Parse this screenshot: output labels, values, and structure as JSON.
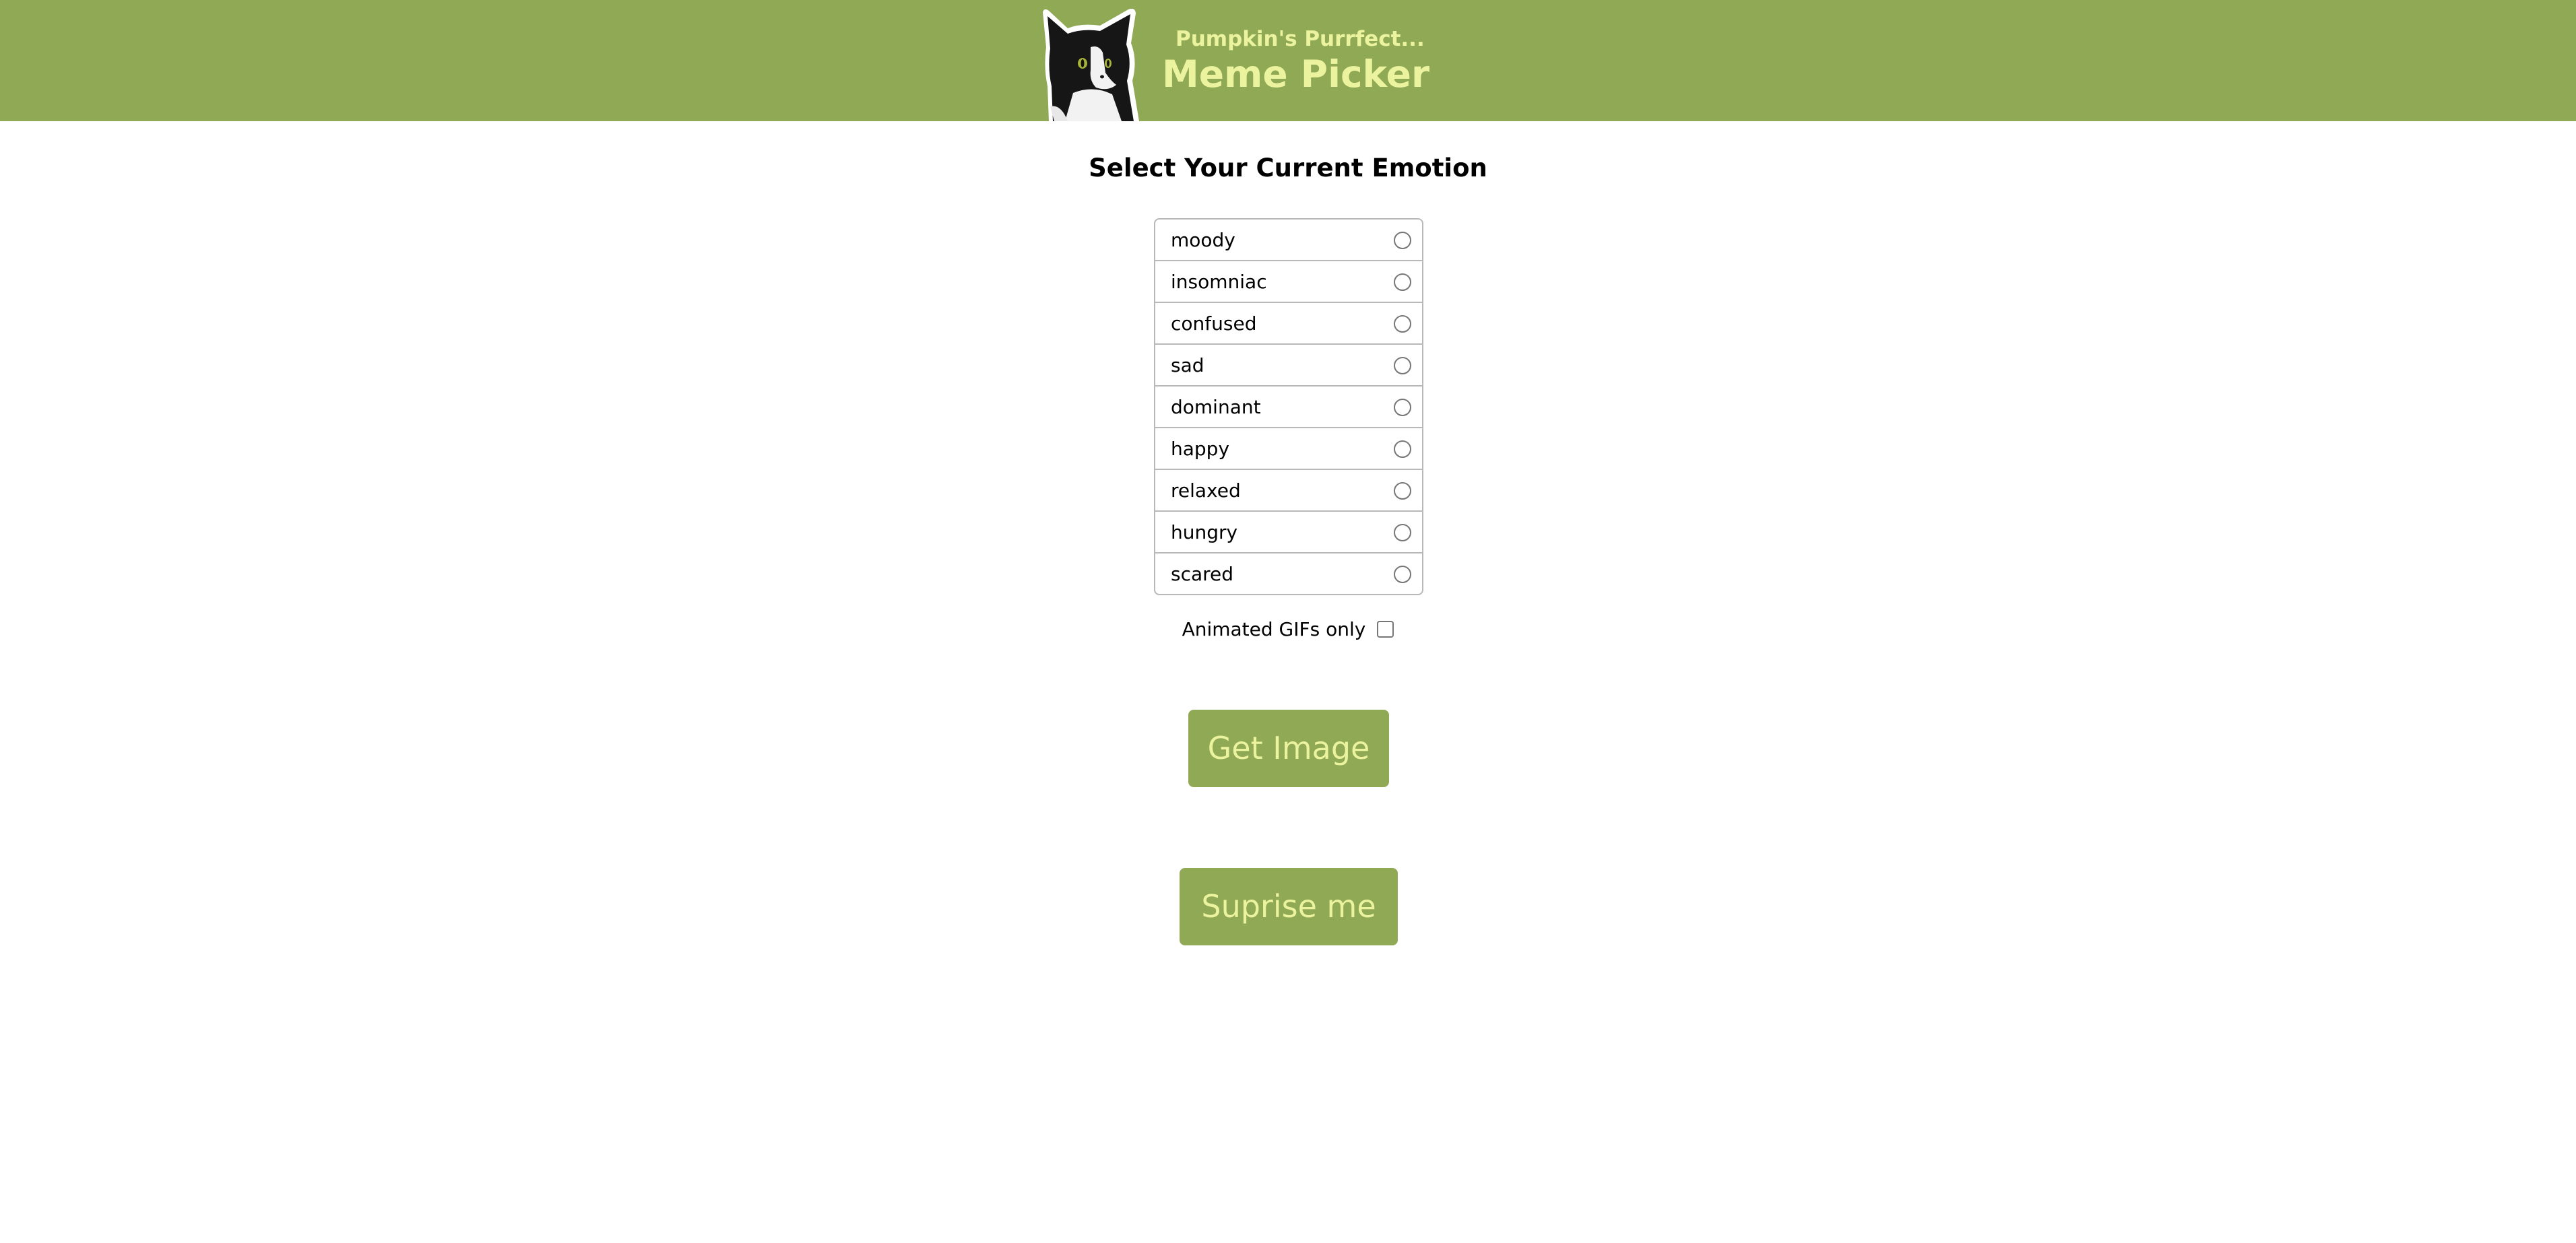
{
  "header": {
    "subtitle": "Pumpkin's Purrfect...",
    "title": "Meme Picker",
    "logo_icon": "cat-icon",
    "background_color": "#90a955",
    "text_color": "#ecf39e"
  },
  "main": {
    "heading": "Select Your Current Emotion",
    "emotions": [
      {
        "label": "moody"
      },
      {
        "label": "insomniac"
      },
      {
        "label": "confused"
      },
      {
        "label": "sad"
      },
      {
        "label": "dominant"
      },
      {
        "label": "happy"
      },
      {
        "label": "relaxed"
      },
      {
        "label": "hungry"
      },
      {
        "label": "scared"
      }
    ],
    "gif_filter_label": "Animated GIFs only",
    "get_image_label": "Get Image",
    "surprise_label": "Suprise me"
  }
}
